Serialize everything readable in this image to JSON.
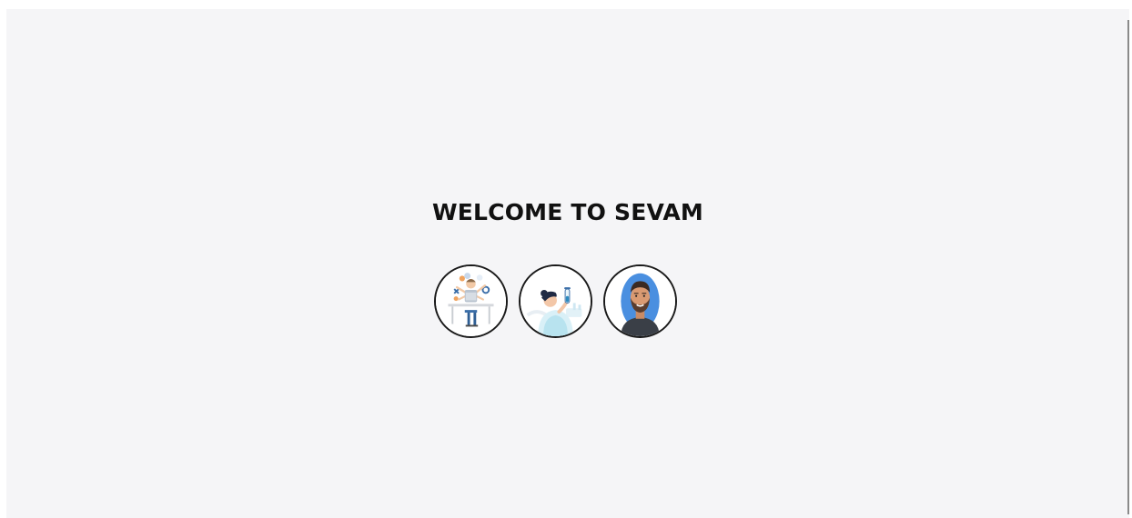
{
  "page": {
    "title": "WELCOME TO SEVAM",
    "background_color": "#f5f5f7"
  },
  "avatars": [
    {
      "icon": "multitasking-developer-illustration-icon"
    },
    {
      "icon": "scientist-with-test-tube-illustration-icon"
    },
    {
      "icon": "bearded-man-avatar-icon"
    }
  ]
}
